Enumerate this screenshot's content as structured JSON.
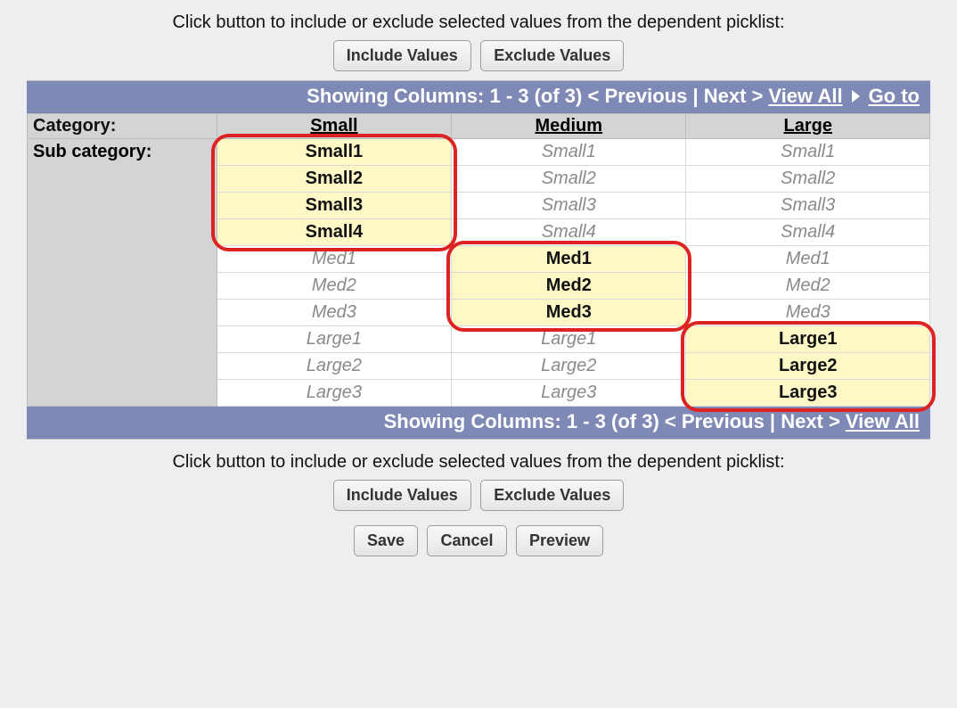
{
  "instruction": "Click button to include or exclude selected values from the dependent picklist:",
  "buttons": {
    "include": "Include Values",
    "exclude": "Exclude Values",
    "save": "Save",
    "cancel": "Cancel",
    "preview": "Preview"
  },
  "pager": {
    "text": "Showing Columns: 1 - 3 (of 3) < Previous | Next >",
    "view_all": "View All",
    "go_to": "Go to"
  },
  "labels": {
    "category": "Category:",
    "subcategory": "Sub category:"
  },
  "columns": [
    "Small",
    "Medium",
    "Large"
  ],
  "rows": [
    {
      "value": "Small1",
      "state": [
        "inc-sel",
        "exc",
        "exc"
      ]
    },
    {
      "value": "Small2",
      "state": [
        "inc-sel",
        "exc",
        "exc"
      ]
    },
    {
      "value": "Small3",
      "state": [
        "inc-sel",
        "exc",
        "exc"
      ]
    },
    {
      "value": "Small4",
      "state": [
        "inc-sel",
        "exc",
        "exc"
      ]
    },
    {
      "value": "Med1",
      "state": [
        "exc",
        "inc-sel",
        "exc"
      ]
    },
    {
      "value": "Med2",
      "state": [
        "exc",
        "inc-sel",
        "exc"
      ]
    },
    {
      "value": "Med3",
      "state": [
        "exc",
        "inc-sel",
        "exc"
      ]
    },
    {
      "value": "Large1",
      "state": [
        "exc",
        "exc",
        "inc-sel"
      ]
    },
    {
      "value": "Large2",
      "state": [
        "exc",
        "exc",
        "inc-sel"
      ]
    },
    {
      "value": "Large3",
      "state": [
        "exc",
        "exc",
        "inc-sel"
      ]
    }
  ],
  "highlights": [
    {
      "col": 0,
      "rowStart": 0,
      "rowEnd": 3
    },
    {
      "col": 1,
      "rowStart": 4,
      "rowEnd": 6
    },
    {
      "col": 2,
      "rowStart": 7,
      "rowEnd": 9
    }
  ]
}
